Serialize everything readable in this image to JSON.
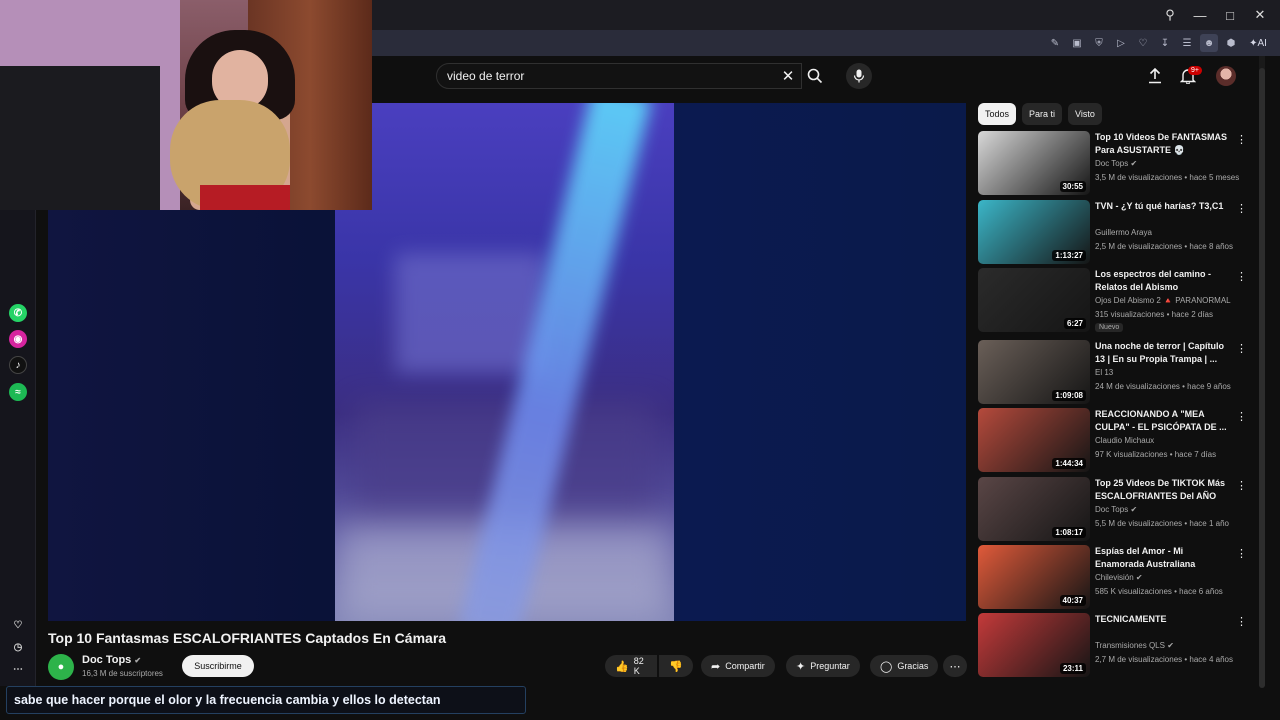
{
  "search": {
    "query": "video de terror"
  },
  "notifications": {
    "count": "9+"
  },
  "video": {
    "title": "Top 10 Fantasmas ESCALOFRIANTES Captados En Cámara",
    "channel": "Doc Tops",
    "subscribers": "16,3 M de suscriptores",
    "subscribe_label": "Suscribirme",
    "likes": "82 K",
    "share_label": "Compartir",
    "ask_label": "Preguntar",
    "thanks_label": "Gracias"
  },
  "caption": "sabe que hacer porque el olor y la frecuencia cambia y ellos lo detectan",
  "chips": [
    "Todos",
    "Para ti",
    "Visto"
  ],
  "browser": {
    "ai_label": "AI"
  },
  "recommendations": [
    {
      "title": "Top 10 Videos De FANTASMAS Para ASUSTARTE 💀",
      "channel": "Doc Tops",
      "verified": true,
      "meta": "3,5 M de visualizaciones • hace 5 meses",
      "duration": "30:55",
      "thumb_color": "#d8d8d8"
    },
    {
      "title": "TVN - ¿Y tú qué harías? T3,C1",
      "channel": "Guillermo Araya",
      "verified": false,
      "meta": "2,5 M de visualizaciones • hace 8 años",
      "duration": "1:13:27",
      "thumb_color": "#3bb6c8"
    },
    {
      "title": "Los espectros del camino - Relatos del Abismo",
      "channel": "Ojos Del Abismo 2 🔺 PARANORMAL",
      "verified": false,
      "meta": "315 visualizaciones • hace 2 días",
      "duration": "6:27",
      "thumb_color": "#2b2b2b",
      "badge": "Nuevo"
    },
    {
      "title": "Una noche de terror | Capítulo 13 | En su Propia Trampa | ...",
      "channel": "El 13",
      "verified": false,
      "meta": "24 M de visualizaciones • hace 9 años",
      "duration": "1:09:08",
      "thumb_color": "#6a5f58"
    },
    {
      "title": "REACCIONANDO A \"MEA CULPA\" - EL PSICÓPATA DE ...",
      "channel": "Claudio Michaux",
      "verified": false,
      "meta": "97 K visualizaciones • hace 7 días",
      "duration": "1:44:34",
      "thumb_color": "#b54a3c"
    },
    {
      "title": "Top 25 Videos De TIKTOK Más ESCALOFRIANTES Del AÑO",
      "channel": "Doc Tops",
      "verified": true,
      "meta": "5,5 M de visualizaciones • hace 1 año",
      "duration": "1:08:17",
      "thumb_color": "#5a4646"
    },
    {
      "title": "Espías del Amor - Mi Enamorada Australiana",
      "channel": "Chilevisión",
      "verified": true,
      "meta": "585 K visualizaciones • hace 6 años",
      "duration": "40:37",
      "thumb_color": "#e05a3a"
    },
    {
      "title": "TECNICAMENTE",
      "channel": "Transmisiones QLS",
      "verified": true,
      "meta": "2,7 M de visualizaciones • hace 4 años",
      "duration": "23:11",
      "thumb_color": "#c43a3a"
    }
  ]
}
